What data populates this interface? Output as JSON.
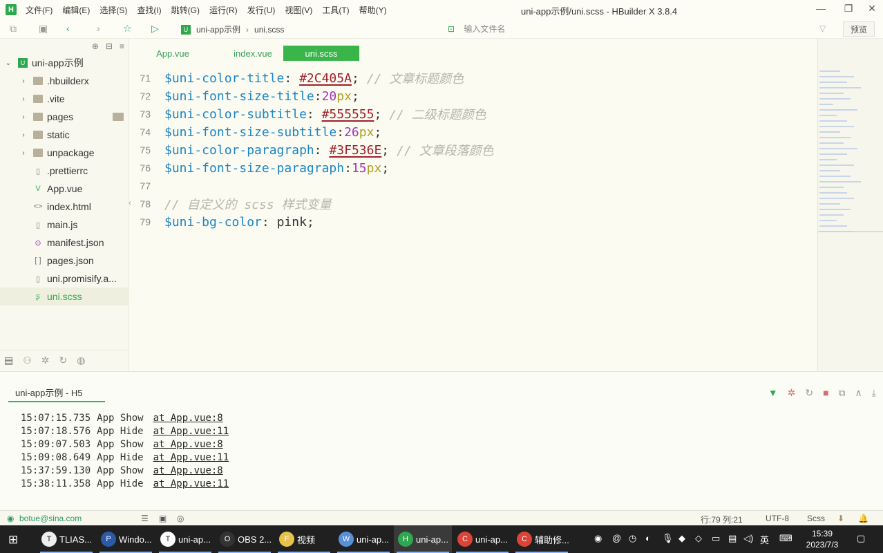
{
  "window": {
    "title": "uni-app示例/uni.scss - HBuilder X 3.8.4",
    "logo": "H",
    "menu": [
      "文件(F)",
      "编辑(E)",
      "选择(S)",
      "查找(I)",
      "跳转(G)",
      "运行(R)",
      "发行(U)",
      "视图(V)",
      "工具(T)",
      "帮助(Y)"
    ]
  },
  "toolbar": {
    "breadcrumb_root": "uni-app示例",
    "breadcrumb_file": "uni.scss",
    "search_placeholder": "输入文件名",
    "preview_label": "预览"
  },
  "sidebar": {
    "root": "uni-app示例",
    "items": [
      {
        "label": ".hbuilderx",
        "type": "folder",
        "icon": "folder-icon"
      },
      {
        "label": ".vite",
        "type": "folder",
        "icon": "folder-icon"
      },
      {
        "label": "pages",
        "type": "folder",
        "icon": "folder-icon"
      },
      {
        "label": "static",
        "type": "folder",
        "icon": "folder-icon"
      },
      {
        "label": "unpackage",
        "type": "folder",
        "icon": "folder-icon"
      },
      {
        "label": ".prettierrc",
        "type": "file",
        "icon": "file-icon"
      },
      {
        "label": "App.vue",
        "type": "file",
        "icon": "vue-file-icon"
      },
      {
        "label": "index.html",
        "type": "file",
        "icon": "html-file-icon"
      },
      {
        "label": "main.js",
        "type": "file",
        "icon": "js-file-icon"
      },
      {
        "label": "manifest.json",
        "type": "file",
        "icon": "manifest-file-icon"
      },
      {
        "label": "pages.json",
        "type": "file",
        "icon": "json-file-icon"
      },
      {
        "label": "uni.promisify.a...",
        "type": "file",
        "icon": "js-file-icon"
      },
      {
        "label": "uni.scss",
        "type": "file",
        "icon": "scss-file-icon",
        "selected": true
      }
    ]
  },
  "editor": {
    "tabs": [
      {
        "label": "App.vue",
        "active": false
      },
      {
        "label": "index.vue",
        "active": false
      },
      {
        "label": "uni.scss",
        "active": true
      }
    ],
    "lines": [
      {
        "n": "71",
        "var": "$uni-color-title",
        "sep": ": ",
        "val": "#2C405A",
        "kind": "hex",
        "unit": "",
        "end": ";",
        "comment": " // 文章标题颜色"
      },
      {
        "n": "72",
        "var": "$uni-font-size-title",
        "sep": ":",
        "val": "20",
        "kind": "num",
        "unit": "px",
        "end": ";",
        "comment": ""
      },
      {
        "n": "73",
        "var": "$uni-color-subtitle",
        "sep": ": ",
        "val": "#555555",
        "kind": "hex",
        "unit": "",
        "end": ";",
        "comment": " // 二级标题颜色"
      },
      {
        "n": "74",
        "var": "$uni-font-size-subtitle",
        "sep": ":",
        "val": "26",
        "kind": "num",
        "unit": "px",
        "end": ";",
        "comment": ""
      },
      {
        "n": "75",
        "var": "$uni-color-paragraph",
        "sep": ": ",
        "val": "#3F536E",
        "kind": "hex",
        "unit": "",
        "end": ";",
        "comment": " // 文章段落颜色"
      },
      {
        "n": "76",
        "var": "$uni-font-size-paragraph",
        "sep": ":",
        "val": "15",
        "kind": "num",
        "unit": "px",
        "end": ";",
        "comment": ""
      },
      {
        "n": "77",
        "var": "",
        "sep": "",
        "val": "",
        "kind": "none",
        "unit": "",
        "end": "",
        "comment": ""
      },
      {
        "n": "78",
        "var": "",
        "sep": "",
        "val": "",
        "kind": "none",
        "unit": "",
        "end": "",
        "comment": "// 自定义的 scss 样式变量"
      },
      {
        "n": "79",
        "var": "$uni-bg-color",
        "sep": ": ",
        "val": "pink",
        "kind": "plain",
        "unit": "",
        "end": ";",
        "comment": ""
      }
    ]
  },
  "console": {
    "tab_label": "uni-app示例 - H5",
    "logs": [
      {
        "time": "15:07:15.735",
        "msg": "App Show",
        "link": "at App.vue:8"
      },
      {
        "time": "15:07:18.576",
        "msg": "App Hide",
        "link": "at App.vue:11"
      },
      {
        "time": "15:09:07.503",
        "msg": "App Show",
        "link": "at App.vue:8"
      },
      {
        "time": "15:09:08.649",
        "msg": "App Hide",
        "link": "at App.vue:11"
      },
      {
        "time": "15:37:59.130",
        "msg": "App Show",
        "link": "at App.vue:8"
      },
      {
        "time": "15:38:11.358",
        "msg": "App Hide",
        "link": "at App.vue:11"
      }
    ]
  },
  "statusbar": {
    "user": "botue@sina.com",
    "position": "行:79  列:21",
    "encoding": "UTF-8",
    "language": "Scss"
  },
  "taskbar": {
    "items": [
      {
        "label": "TLIAS...",
        "icon": "T",
        "color": "#eeeeee",
        "active": false
      },
      {
        "label": "Windo...",
        "icon": "P",
        "color": "#2a5aa8",
        "active": false
      },
      {
        "label": "uni-ap...",
        "icon": "T",
        "color": "#ffffff",
        "active": false
      },
      {
        "label": "OBS 2...",
        "icon": "O",
        "color": "#333333",
        "active": false
      },
      {
        "label": "视频",
        "icon": "F",
        "color": "#e8c34a",
        "active": false
      },
      {
        "label": "uni-ap...",
        "icon": "W",
        "color": "#5a8fd8",
        "active": false
      },
      {
        "label": "uni-ap...",
        "icon": "H",
        "color": "#2fa84f",
        "active": true
      },
      {
        "label": "uni-ap...",
        "icon": "C",
        "color": "#db4437",
        "active": false
      },
      {
        "label": "辅助修...",
        "icon": "C",
        "color": "#db4437",
        "active": false
      }
    ],
    "ime": "英",
    "time": "15:39",
    "date": "2023/7/3"
  }
}
